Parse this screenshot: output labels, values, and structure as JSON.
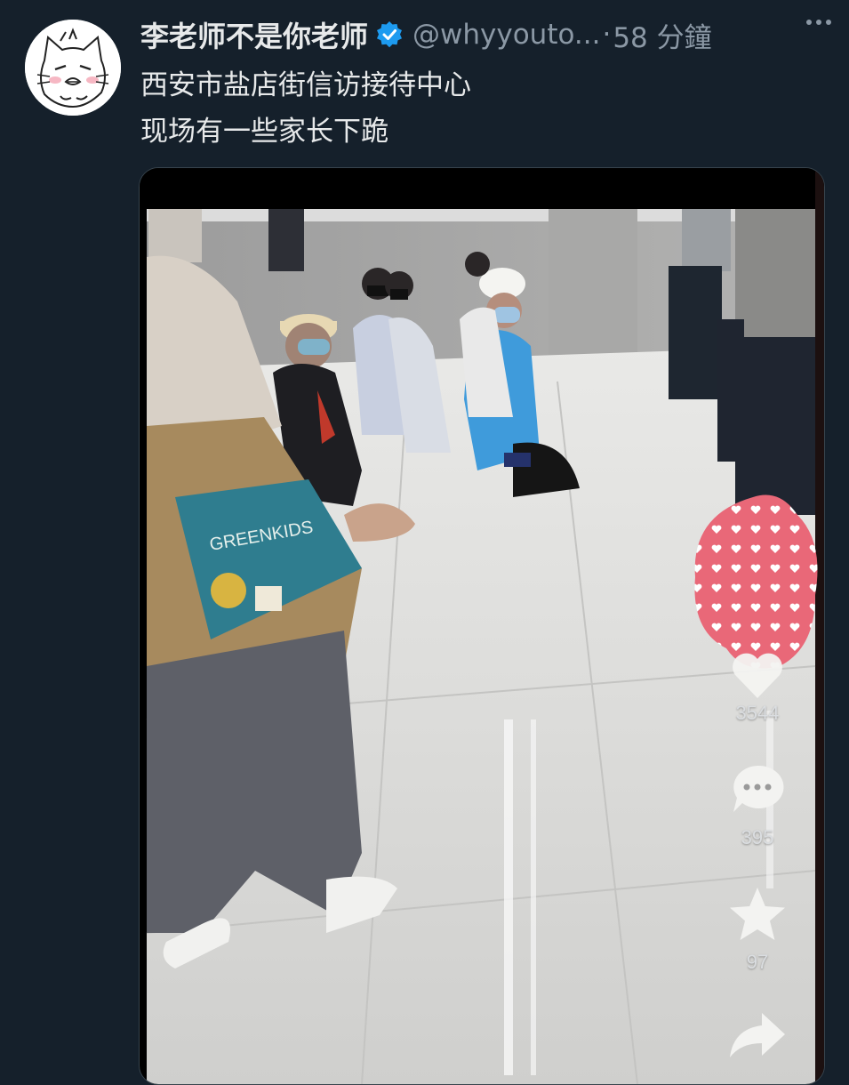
{
  "tweet": {
    "display_name": "李老师不是你老师",
    "handle": "@whyyouto...",
    "separator": "·",
    "time": "58 分鐘",
    "text_lines": [
      "西安市盐店街信访接待中心",
      "现场有一些家长下跪"
    ]
  },
  "icons": {
    "verified": "verified-badge-icon",
    "more": "more-options-icon",
    "like": "heart-icon",
    "comment": "comment-bubble-icon",
    "favorite": "star-icon",
    "share": "share-arrow-icon"
  },
  "video": {
    "like_count": "3544",
    "comment_count": "395",
    "favorite_count": "97"
  },
  "colors": {
    "background": "#15202b",
    "verified_blue": "#1d9bf0",
    "text_primary": "#e7e9ea",
    "text_secondary": "#8b98a5",
    "sticker_pink": "#e96878"
  }
}
